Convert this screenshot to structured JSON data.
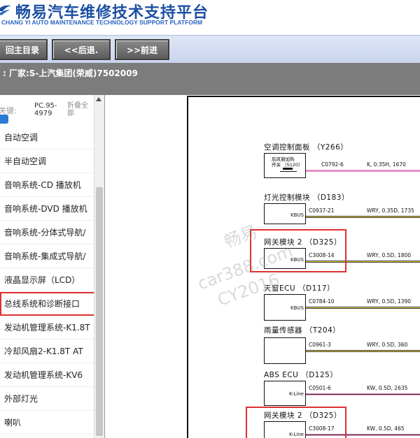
{
  "header": {
    "title": "畅易汽车维修技术支持平台",
    "subtitle": "CHANG YI AUTO MAINTENANCE TECHNOLOGY SUPPORT PLATFORM",
    "brand_color": "#1c4fa3"
  },
  "nav": {
    "home_label": "回主目录",
    "back_label": "<<后退.",
    "forward_label": ">>前进"
  },
  "breadcrumb": {
    "text": ": 厂家:S-上汽集团(荣威)7502009"
  },
  "search": {
    "keyword_label": "关键:",
    "pc_code": "PC.95-4979",
    "collapse_all": "折叠全部"
  },
  "menu": {
    "items": [
      {
        "label": "自动空调"
      },
      {
        "label": "半自动空调"
      },
      {
        "label": "音响系统-CD 播放机"
      },
      {
        "label": "音响系统-DVD 播放机"
      },
      {
        "label": "音响系统-分体式导航/"
      },
      {
        "label": "音响系统-集成式导航/"
      },
      {
        "label": "液晶显示屏（LCD）"
      },
      {
        "label": "总线系统和诊断接口"
      },
      {
        "label": "发动机管理系统-K1.8T"
      },
      {
        "label": "冷却风扇2-K1.8T AT"
      },
      {
        "label": "发动机管理系统-KV6"
      },
      {
        "label": "外部灯光"
      },
      {
        "label": "喇叭"
      }
    ],
    "active_index": 7,
    "highlight_color": "#e03030"
  },
  "diagram": {
    "modules": [
      {
        "title": "空调控制面板 （Y266）",
        "pin": "",
        "switch_label": "后风窗加热",
        "switch_label2": "开关 （S120）",
        "connector": "C0792-6",
        "wire": "K, 0.35H, 1670",
        "wire_color": "pink"
      },
      {
        "title": "灯光控制模块 （D183）",
        "pin": "KBUS",
        "connector": "C0937-21",
        "wire": "WRY, 0.35D, 1735",
        "wire_color": "yellow"
      },
      {
        "title": "网关模块 2 （D325）",
        "pin": "KBUS",
        "connector": "C3008-14",
        "wire": "WRY, 0.5D, 1800",
        "wire_color": "yellow"
      },
      {
        "title": "天窗ECU （D117）",
        "pin": "KBUS",
        "connector": "C0784-10",
        "wire": "WRY, 0.5D, 1390",
        "wire_color": "yellow"
      },
      {
        "title": "雨量传感器 （T204）",
        "pin": "",
        "connector": "C0961-3",
        "wire": "WRY, 0.5D, 360",
        "wire_color": "yellow"
      },
      {
        "title": "ABS ECU （D125）",
        "pin": "K-Line",
        "connector": "C0501-6",
        "wire": "KW, 0.5D, 2635",
        "wire_color": "pinkk"
      },
      {
        "title": "网关模块 2 （D325）",
        "pin": "K-Line",
        "connector": "C3008-17",
        "wire": "KW, 0.5D, 465",
        "wire_color": "pinkk"
      }
    ],
    "watermark": {
      "line1": "畅易",
      "line2": "car388.com",
      "line3": "CY2016"
    }
  }
}
